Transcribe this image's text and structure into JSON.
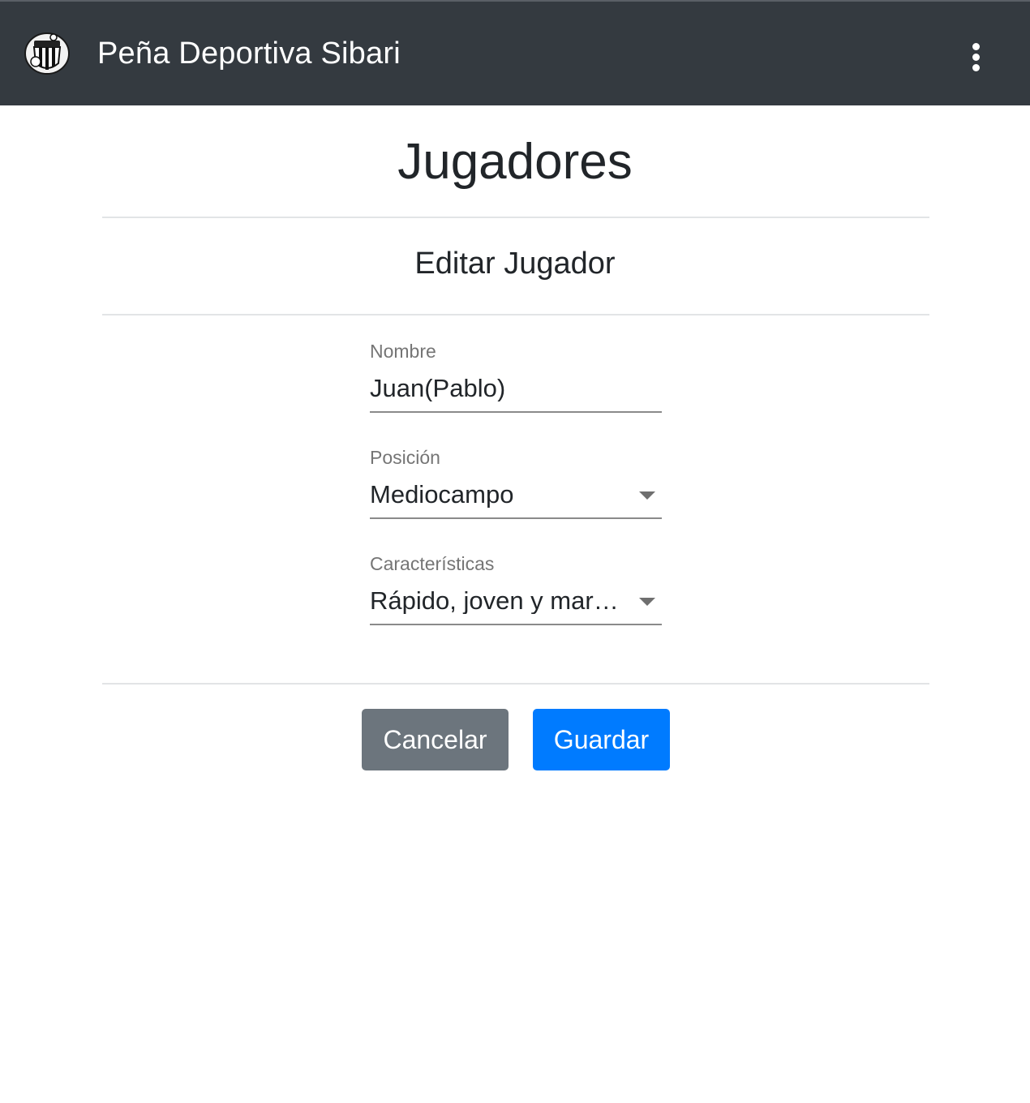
{
  "navbar": {
    "logo_icon": "club-crest-icon",
    "brand": "Peña Deportiva Sibari",
    "menu_icon": "more-vertical-icon"
  },
  "page": {
    "title": "Jugadores",
    "section_title": "Editar Jugador"
  },
  "form": {
    "name": {
      "label": "Nombre",
      "value": "Juan(Pablo)"
    },
    "position": {
      "label": "Posición",
      "value": "Mediocampo",
      "icon": "chevron-down-icon"
    },
    "traits": {
      "label": "Características",
      "value": "Rápido, joven y marc…",
      "icon": "chevron-down-icon"
    }
  },
  "actions": {
    "cancel_label": "Cancelar",
    "save_label": "Guardar"
  },
  "colors": {
    "navbar_bg": "#343a40",
    "cancel_bg": "#6c757d",
    "save_bg": "#007bff"
  }
}
